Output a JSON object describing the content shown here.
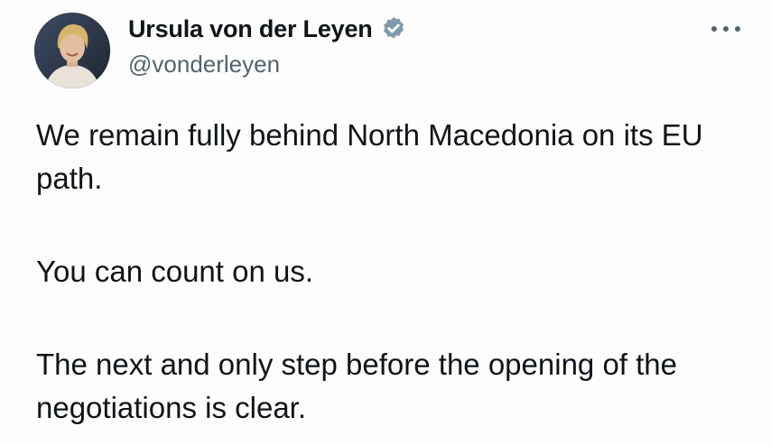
{
  "author": {
    "display_name": "Ursula von der Leyen",
    "handle": "@vonderleyen",
    "verified_icon": "verified-badge-icon",
    "avatar": "profile-photo"
  },
  "menu": {
    "more_icon": "more-options-icon"
  },
  "tweet": {
    "paragraphs": [
      "We remain fully behind North Macedonia on its EU path.",
      "You can count on us.",
      "The next and only step before the opening of the negotiations is clear."
    ]
  },
  "colors": {
    "text": "#0f1419",
    "handle": "#536471",
    "verified": "#829aab"
  }
}
